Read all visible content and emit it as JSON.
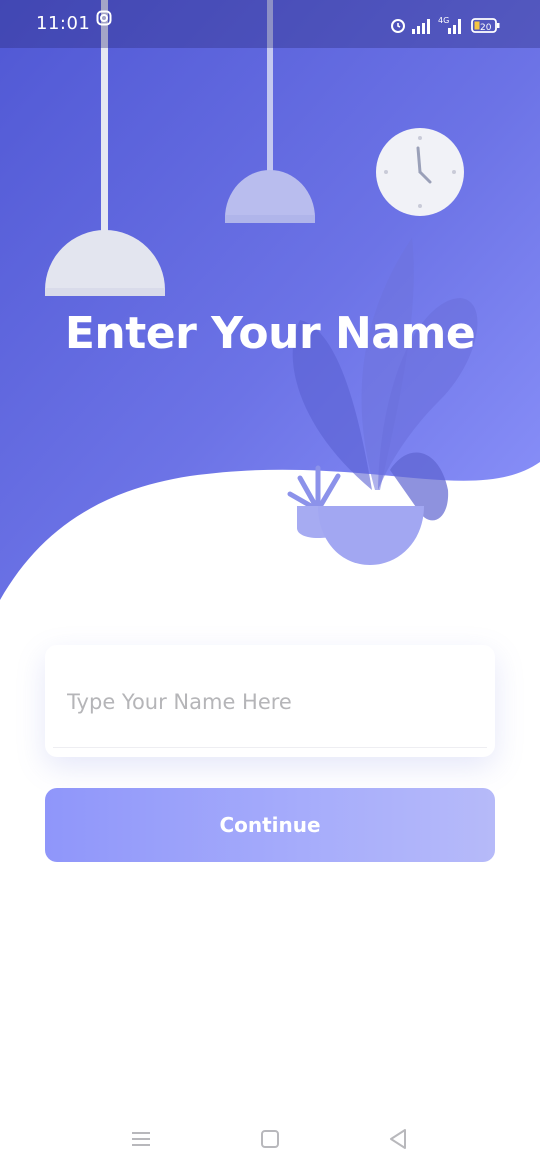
{
  "status_bar": {
    "time": "11:01",
    "left_icons": [
      "instagram-icon"
    ],
    "right_icons": [
      "alarm-icon",
      "signal-icon",
      "4g-signal-icon",
      "battery-icon"
    ],
    "network_label": "4G",
    "battery_level": "20"
  },
  "page": {
    "title": "Enter Your Name"
  },
  "form": {
    "name_placeholder": "Type Your Name Here",
    "name_value": "",
    "continue_label": "Continue"
  },
  "nav_bar": {
    "buttons": [
      "menu-icon",
      "home-icon",
      "back-icon"
    ]
  },
  "colors": {
    "gradient_start": "#5259d6",
    "gradient_end": "#8a90fb",
    "button_start": "#8f96fa",
    "button_end": "#b6baf9",
    "white": "#ffffff"
  }
}
